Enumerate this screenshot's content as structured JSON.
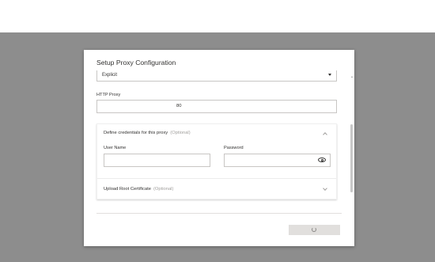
{
  "dialog": {
    "title": "Setup Proxy Configuration"
  },
  "proxy_type": {
    "selected": "Explicit"
  },
  "http_proxy": {
    "label": "HTTP Proxy",
    "port_value": "80"
  },
  "credentials_section": {
    "title": "Define credentials for this proxy",
    "optional_label": "(Optional)",
    "expanded": true,
    "username_label": "User Name",
    "username_value": "",
    "password_label": "Password",
    "password_value": ""
  },
  "root_cert_section": {
    "title": "Upload Root Certificate",
    "optional_label": "(Optional)",
    "expanded": false
  },
  "icons": {
    "dropdown": "chevron-down-icon",
    "credentials_toggle": "chevron-up-icon",
    "root_cert_toggle": "chevron-down-icon",
    "password_reveal": "eye-icon",
    "loading": "spinner-icon"
  },
  "colors": {
    "backdrop": "#8d8d8d",
    "border": "#c8c6c4",
    "muted_text": "#a19f9d",
    "disabled_button": "#e1dfdd"
  }
}
